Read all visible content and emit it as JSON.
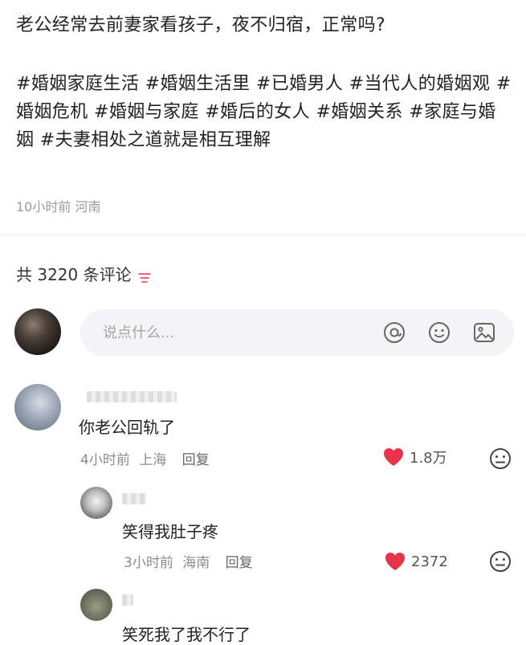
{
  "post": {
    "title": "老公经常去前妻家看孩子，夜不归宿，正常吗?",
    "tags": "#婚姻家庭生活 #婚姻生活里 #已婚男人 #当代人的婚姻观 #婚姻危机 #婚姻与家庭 #婚后的女人 #婚姻关系 #家庭与婚姻 #夫妻相处之道就是相互理解",
    "meta": "10小时前 河南"
  },
  "comments_header": {
    "count_text": "共 3220 条评论"
  },
  "input": {
    "placeholder": "说点什么..."
  },
  "icons": {
    "at": "at-icon",
    "emoji": "emoji-icon",
    "image": "image-icon",
    "filter": "filter-icon",
    "like": "heart-icon"
  },
  "colors": {
    "heart": "#e8334a",
    "tag_text": "#222222",
    "meta_text": "#9a9a9a"
  },
  "comments": [
    {
      "text": "你老公回轨了",
      "time": "4小时前",
      "location": "上海",
      "reply_label": "回复",
      "likes": "1.8万"
    },
    {
      "text": "笑得我肚子疼",
      "time": "3小时前",
      "location": "海南",
      "reply_label": "回复",
      "likes": "2372"
    },
    {
      "text": "笑死我了我不行了"
    }
  ]
}
